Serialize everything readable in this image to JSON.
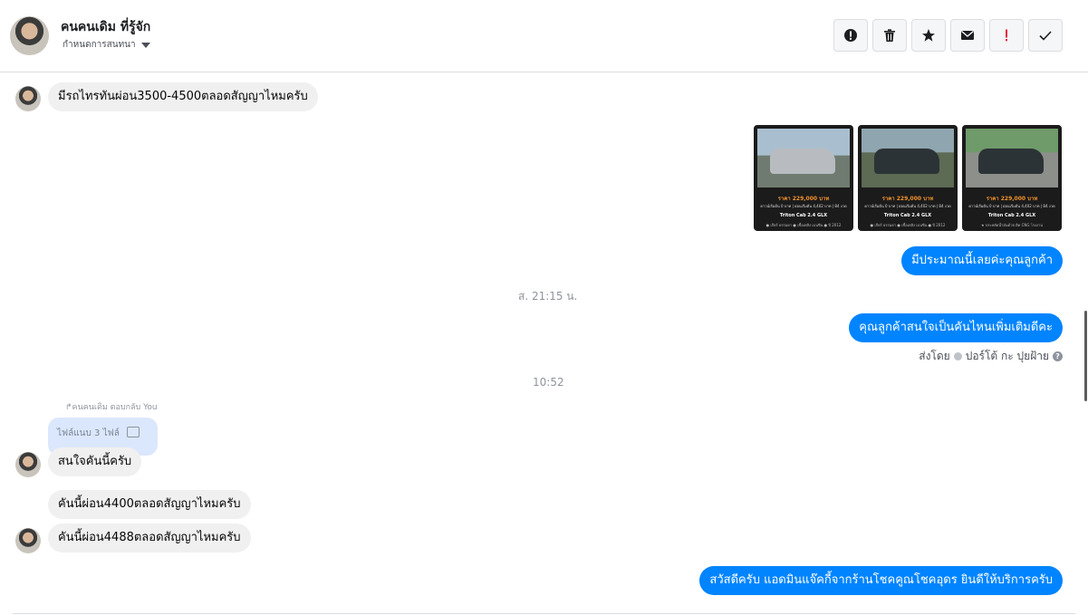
{
  "header": {
    "contact_name": "คนคนเดิม ที่รู้จัก",
    "subline": "กำหนดการสนทนา"
  },
  "actions": [
    {
      "name": "important-icon"
    },
    {
      "name": "trash-icon"
    },
    {
      "name": "star-icon"
    },
    {
      "name": "envelope-icon"
    },
    {
      "name": "spam-icon"
    },
    {
      "name": "check-icon"
    }
  ],
  "messages": {
    "m1": "มีรถไทรทันผ่อน3500-4500ตลอดสัญญาไหมครับ",
    "m2": "มีประมาณนี้เลยค่ะคุณลูกค้า",
    "m3": "คุณลูกค้าสนใจเป็นคันไหนเพิ่มเติมดีคะ",
    "m4": "สนใจคันนี้ครับ",
    "m5": "คันนี้ผ่อน4400ตลอดสัญญาไหมครับ",
    "m6": "คันนี้ผ่อน4488ตลอดสัญญาไหมครับ",
    "m7": "สวัสดีครับ แอดมินแจ๊คกี้จากร้านโชคคูณโชคอุดร ยินดีให้บริการครับ"
  },
  "timestamps": {
    "t1": "ส. 21:15 น.",
    "t2": "10:52"
  },
  "sent_by": {
    "prefix": "ส่งโดย",
    "name": "ปอร์โต้ กะ ปุยฝ้าย"
  },
  "reply": {
    "note": "คนคนเดิม ตอบกลับ You",
    "attachment_label": "ไฟล์แนบ 3 ไฟล์"
  },
  "cars": [
    {
      "price": "ราคา 229,000 บาท",
      "line2": "ดาวน์เริ่มต้น 0 บาท | ผ่อนเริ่มต้น 4,402 บาท | 84 งวด",
      "model": "Triton Cab 2.4 GLX",
      "line4": "● เกียร์ ธรรมดา  ● เชื้อเพลิง เบนซิน  ● ปี 2012"
    },
    {
      "price": "ราคา 229,000 บาท",
      "line2": "ดาวน์เริ่มต้น 0 บาท | ผ่อนเริ่มต้น 4,402 บาท | 84 งวด",
      "model": "Triton Cab 2.4 GLX",
      "line4": "● เกียร์ ธรรมดา  ● เชื้อเพลิง เบนซิน  ● ปี 2012"
    },
    {
      "price": "ราคา 229,000 บาท",
      "line2": "ดาวน์เริ่มต้น 0 บาท | ผ่อนเริ่มต้น 4,402 บาท | 84 งวด",
      "model": "Triton Cab 2.4 GLX",
      "line4": "★ ประหยัดน้ำมันด้วย ติด CNG โรงงาน"
    }
  ]
}
